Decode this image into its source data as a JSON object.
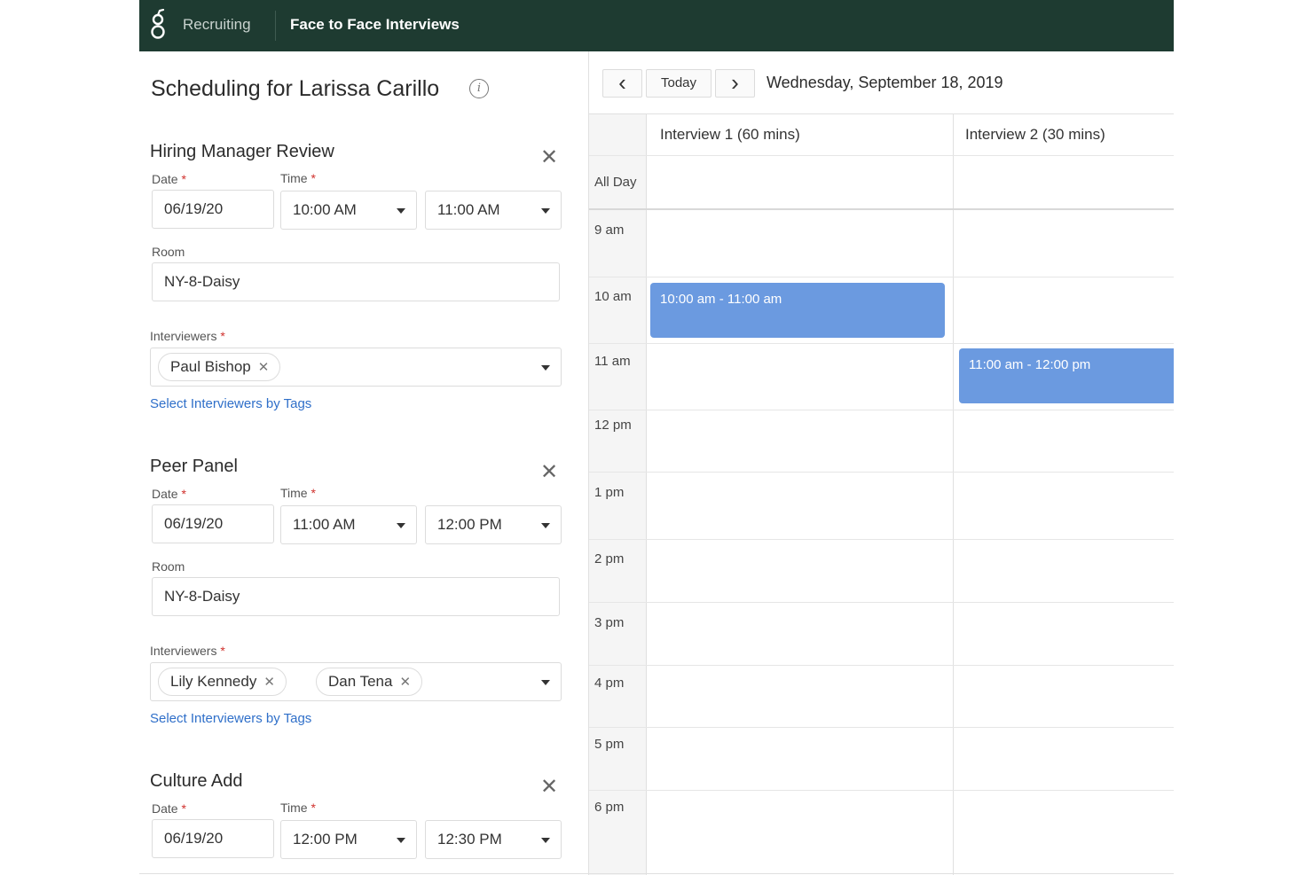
{
  "topbar": {
    "recruiting": "Recruiting",
    "current": "Face to Face Interviews"
  },
  "page": {
    "title": "Scheduling for Larissa Carillo",
    "info_glyph": "i"
  },
  "labels": {
    "date": "Date",
    "time": "Time",
    "room": "Room",
    "interviewers": "Interviewers",
    "required": "*",
    "select_by_tags": "Select Interviewers by Tags",
    "close": "✕",
    "chip_remove": "✕"
  },
  "sections": [
    {
      "title": "Hiring Manager Review",
      "date": "06/19/20",
      "start": "10:00 AM",
      "end": "11:00 AM",
      "room": "NY-8-Daisy",
      "interviewers": [
        "Paul Bishop"
      ]
    },
    {
      "title": "Peer Panel",
      "date": "06/19/20",
      "start": "11:00 AM",
      "end": "12:00 PM",
      "room": "NY-8-Daisy",
      "interviewers": [
        "Lily Kennedy",
        "Dan Tena"
      ]
    },
    {
      "title": "Culture Add",
      "date": "06/19/20",
      "start": "12:00 PM",
      "end": "12:30 PM"
    }
  ],
  "calendar": {
    "prev": "‹",
    "today": "Today",
    "next": "›",
    "date": "Wednesday, September 18, 2019",
    "columns": [
      "Interview 1 (60 mins)",
      "Interview 2 (30 mins)"
    ],
    "all_day": "All Day",
    "hours": [
      "9 am",
      "10 am",
      "11 am",
      "12 pm",
      "1 pm",
      "2 pm",
      "3 pm",
      "4 pm",
      "5 pm",
      "6 pm"
    ],
    "events": [
      {
        "label": "10:00 am - 11:00 am",
        "color": "#6b9ae0"
      },
      {
        "label": "11:00 am - 12:00 pm",
        "color": "#6b9ae0"
      }
    ]
  },
  "colors": {
    "topbar": "#1e3b31",
    "link": "#2f6fc9",
    "required": "#d0312d"
  }
}
